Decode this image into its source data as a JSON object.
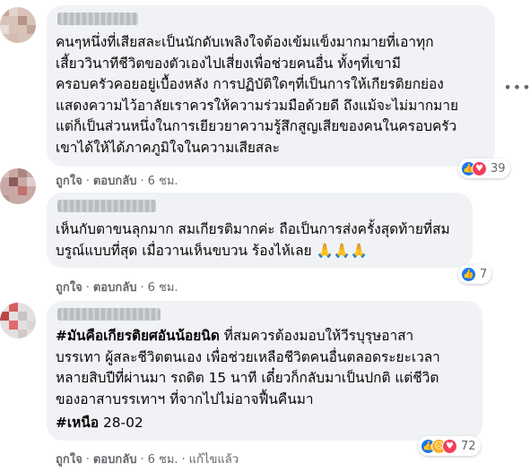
{
  "comments": [
    {
      "author": "",
      "lines": [
        "คนๆหนึ่งที่เสียสละเป็นนักดับเพลิงใจต้องเข้มแข็งมากมายที่เอาทุก",
        "เสี้ยววินาทีชีวิตของตัวเองไปเสี่ยงเพื่อช่วยคนอื่น ทั้งๆที่เขามี",
        "ครอบครัวคอยอยู่เบื้องหลัง การปฏิบัติใดๆที่เป็นการให้เกียรติยกย่อง",
        "แสดงความไว้อาลัยเราควรให้ความร่วมมือด้วยดี ถึงแม้จะไม่มากมาย",
        "แต่ก็เป็นส่วนหนึ่งในการเยียวยาความรู้สึกสูญเสียของคนในครอบครัว",
        "เขาได้ให้ได้ภาคภูมิใจในความเสียสละ"
      ],
      "reaction_count": "39",
      "like_label": "ถูกใจ",
      "reply_label": "ตอบกลับ",
      "time": "6 ชม."
    },
    {
      "author": "",
      "lines": [
        "เห็นกับตาขนลุกมาก สมเกียรติมากค่ะ ถือเป็นการส่งครั้งสุดท้ายที่สม",
        "บรูณ์แบบที่สุด เมื่อวานเห็นขบวน ร้องไห้เลย 🙏🙏🙏"
      ],
      "reaction_count": "7",
      "like_label": "ถูกใจ",
      "reply_label": "ตอบกลับ",
      "time": "6 ชม."
    },
    {
      "author": "",
      "hashtag": "#มันคือเกียรติยศอันน้อยนิด",
      "first_line_rest": " ที่สมควรต้องมอบให้วีรบุรุษอาสา",
      "lines": [
        "บรรเทา ผู้สละชีวิตตนเอง เพื่อช่วยเหลือชีวิตคนอื่นตลอดระยะเวลา",
        "หลายสิบปีที่ผ่านมา รถดิต 15 นาที เดี๋ยวก็กลับมาเป็นปกติ แต่ชีวิต",
        "ของอาสาบรรเทาฯ ที่จากไปไม่อาจฟื้นคืนมา"
      ],
      "tag": "#เหนือ",
      "tag_rest": " 28-02",
      "reaction_count": "72",
      "like_label": "ถูกใจ",
      "reply_label": "ตอบกลับ",
      "time": "6 ชม.",
      "edited_label": "แก้ไขแล้ว"
    }
  ],
  "separator": "·",
  "more_icon": "more-horizontal-icon",
  "colors": {
    "bubble": "#f0f2f5",
    "text": "#050505",
    "meta": "#65676b",
    "like_blue": "#1877f2",
    "love_red": "#f33e58",
    "sad_yellow": "#f7b125"
  }
}
